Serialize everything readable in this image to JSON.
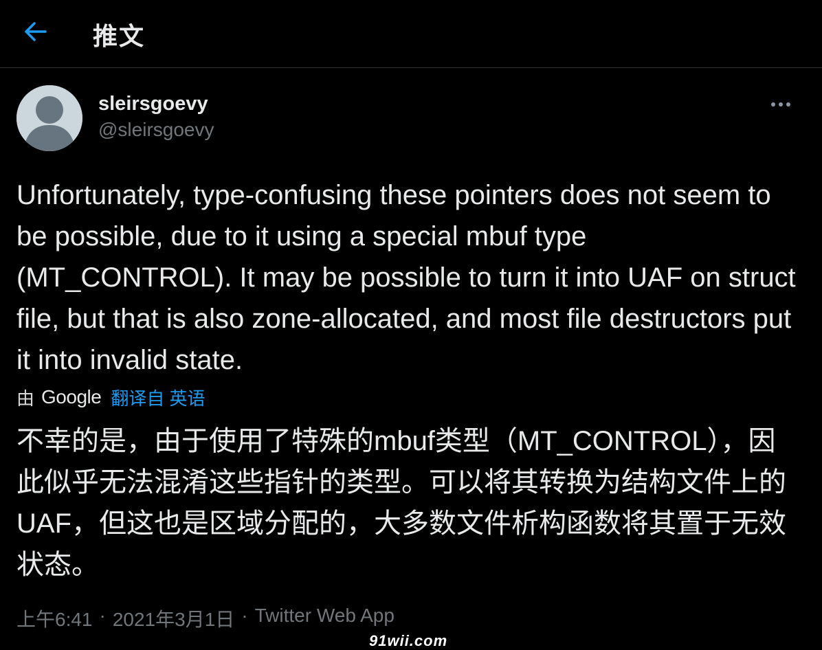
{
  "header": {
    "title": "推文",
    "back_icon": "arrow-left-icon",
    "accent_color": "#1d9bf0"
  },
  "tweet": {
    "display_name": "sleirsgoevy",
    "handle": "@sleirsgoevy",
    "more_icon": "more-horizontal-icon",
    "text": "Unfortunately, type-confusing these pointers does not seem to be possible, due to it using a special mbuf type (MT_CONTROL). It may be possible to turn it into UAF on struct file, but that is also zone-allocated, and most file destructors put it into invalid state.",
    "translation": {
      "by_label": "由",
      "provider": "Google",
      "link_label": "翻译自 英语",
      "text": "不幸的是，由于使用了特殊的mbuf类型（MT_CONTROL），因此似乎无法混淆这些指针的类型。可以将其转换为结构文件上的UAF，但这也是区域分配的，大多数文件析构函数将其置于无效状态。"
    },
    "time": "上午6:41",
    "separator": "·",
    "date": "2021年3月1日",
    "source": "Twitter Web App"
  },
  "watermark": "91wii.com"
}
